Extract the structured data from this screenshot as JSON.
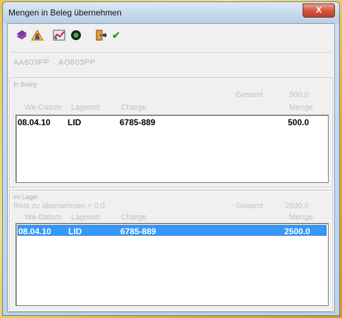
{
  "window": {
    "title": "Mengen in Beleg übernehmen",
    "close_label": "X"
  },
  "toolbar": {
    "icons": [
      "books-icon",
      "person-icon",
      "chart-icon",
      "record-icon",
      "exit-door-icon",
      "checkmark-icon"
    ]
  },
  "codes": [
    "AA603PP",
    "AO603PP"
  ],
  "in_beleg": {
    "label": "In Beleg",
    "gesamt_label": "Gesamt",
    "gesamt_value": "500.0",
    "headers": {
      "date": "We-Datum",
      "lagerort": "Lagerort",
      "charge": "Charge",
      "menge": "Menge"
    },
    "rows": [
      {
        "date": "08.04.10",
        "lagerort": "LID",
        "charge": "6785-889",
        "menge": "500.0"
      }
    ]
  },
  "im_lager": {
    "label": "im Lager",
    "rest_label": "Rest zu übernehmen = 0.0",
    "gesamt_label": "Gesamt",
    "gesamt_value": "2500.0",
    "headers": {
      "date": "We-Datum",
      "lagerort": "Lagerort",
      "charge": "Charge",
      "menge": "Menge"
    },
    "rows": [
      {
        "date": "08.04.10",
        "lagerort": "LID",
        "charge": "6785-889",
        "menge": "2500.0",
        "selected": true
      }
    ]
  },
  "colors": {
    "selection": "#3399ff",
    "muted_text": "#b7c2d0",
    "close_button": "#d0533a"
  }
}
